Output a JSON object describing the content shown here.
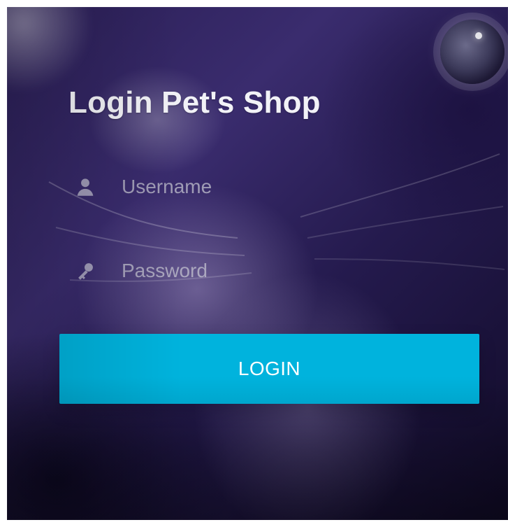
{
  "login": {
    "title": "Login Pet's Shop",
    "username_placeholder": "Username",
    "password_placeholder": "Password",
    "submit_label": "LOGIN"
  },
  "icons": {
    "username": "user-icon",
    "password": "key-icon"
  },
  "colors": {
    "button_bg": "#00b3dd",
    "title_text": "#f2f2f7"
  }
}
